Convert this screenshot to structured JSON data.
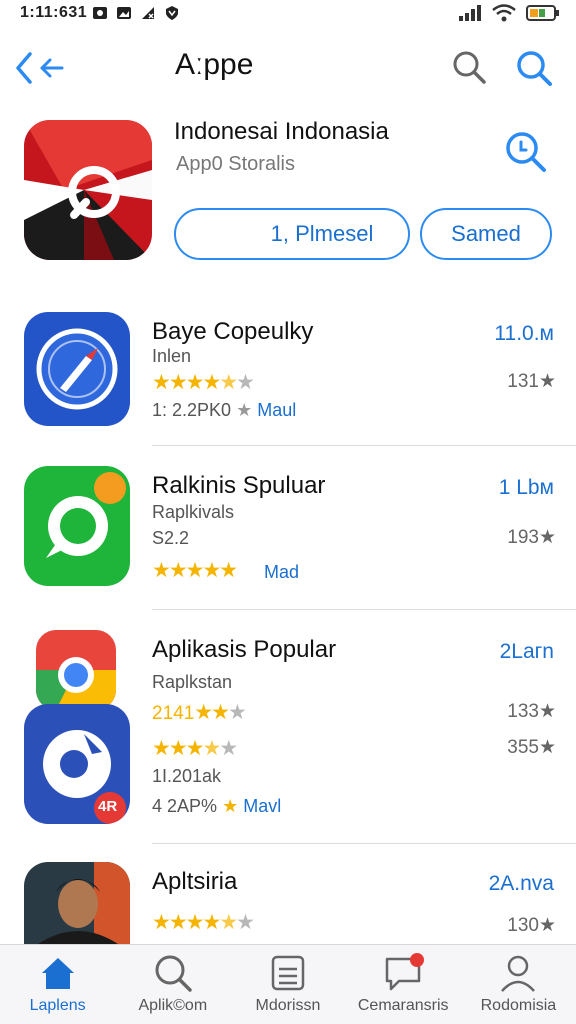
{
  "status_bar": {
    "time": "1:11:631",
    "icons": [
      "photo-icon",
      "image-icon",
      "signal-x-icon",
      "shield-icon"
    ],
    "right_icons": [
      "cellular-signal-icon",
      "wifi-icon",
      "battery-icon"
    ]
  },
  "nav": {
    "title": "Aːppe",
    "back_icon": "back-arrow-icon",
    "search_icons": [
      "search-icon",
      "search-icon"
    ]
  },
  "featured": {
    "title": "Indonesai Indonasia",
    "subtitle": "App0 Storalis",
    "primary_button": "1, Plmesel",
    "secondary_button": "Samed"
  },
  "apps": [
    {
      "name": "Baye Copeulky",
      "line1": "Inlen",
      "rating_stars": 3.5,
      "line2_prefix": "1: 2.2PK0",
      "line2_link": "Maul",
      "size": "11.0.м",
      "count": "131★"
    },
    {
      "name": "Ralkinis Spuluar",
      "line1": "Raplkivals",
      "line2": "S2.2",
      "rating_stars": 5,
      "rating_link": "Mad",
      "size": "1 Lbм",
      "count": "193★"
    },
    {
      "name": "Aplikasis Popular",
      "line1": "Raplkstan",
      "rating_prefix": "2141",
      "rating_stars_a": 3,
      "rating_stars_b": 2.5,
      "line2": "1I.201ak",
      "line3_prefix": "4 2AP%",
      "line3_link": "Mavl",
      "size": "2Laгn",
      "count_a": "133★",
      "count_b": "355★",
      "badge": "4R"
    },
    {
      "name": "Apltsiria",
      "rating_stars": 4.5,
      "size": "2A.nva",
      "count": "130★"
    }
  ],
  "tabs": [
    {
      "label": "Laplens",
      "icon": "home-icon",
      "active": true
    },
    {
      "label": "Aplik©om",
      "icon": "search-icon",
      "active": false
    },
    {
      "label": "Mdorissn",
      "icon": "list-icon",
      "active": false
    },
    {
      "label": "Cemaransris",
      "icon": "message-icon",
      "active": false
    },
    {
      "label": "Rodomisia",
      "icon": "person-icon",
      "active": false
    }
  ],
  "colors": {
    "accent": "#1a6fd0",
    "star": "#f5b400",
    "badge": "#e53935"
  }
}
